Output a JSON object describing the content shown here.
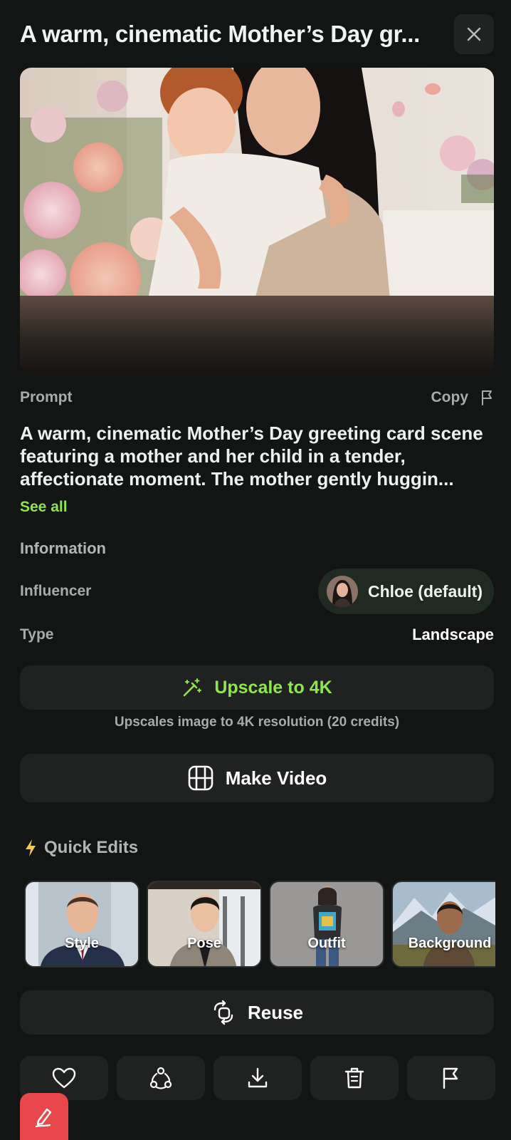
{
  "header": {
    "title": "A warm, cinematic Mother’s Day gr...",
    "close_icon": "close-icon"
  },
  "prompt": {
    "label": "Prompt",
    "copy_label": "Copy",
    "text": "A warm, cinematic Mother’s Day greeting card scene featuring a mother and her child in a tender, affectionate moment. The mother gently huggin...",
    "see_all": "See all"
  },
  "information": {
    "title": "Information",
    "influencer_label": "Influencer",
    "influencer_value": "Chloe (default)",
    "type_label": "Type",
    "type_value": "Landscape"
  },
  "upscale": {
    "label": "Upscale to 4K",
    "note": "Upscales image to 4K resolution (20 credits)",
    "icon": "magic-wand-icon"
  },
  "make_video": {
    "label": "Make Video",
    "icon": "film-icon"
  },
  "quick_edits": {
    "title": "Quick Edits",
    "icon": "lightning-icon",
    "items": [
      {
        "label": "Style"
      },
      {
        "label": "Pose"
      },
      {
        "label": "Outfit"
      },
      {
        "label": "Background"
      }
    ]
  },
  "reuse": {
    "label": "Reuse",
    "icon": "reuse-icon"
  },
  "actions": [
    "heart-icon",
    "share-nodes-icon",
    "download-icon",
    "trash-icon",
    "flag-icon"
  ],
  "fab": {
    "icon": "edit-pen-icon"
  },
  "colors": {
    "background": "#121514",
    "accent_green": "#8ee64a",
    "fab_red": "#e8474b",
    "button_bg": "#1f2220"
  }
}
